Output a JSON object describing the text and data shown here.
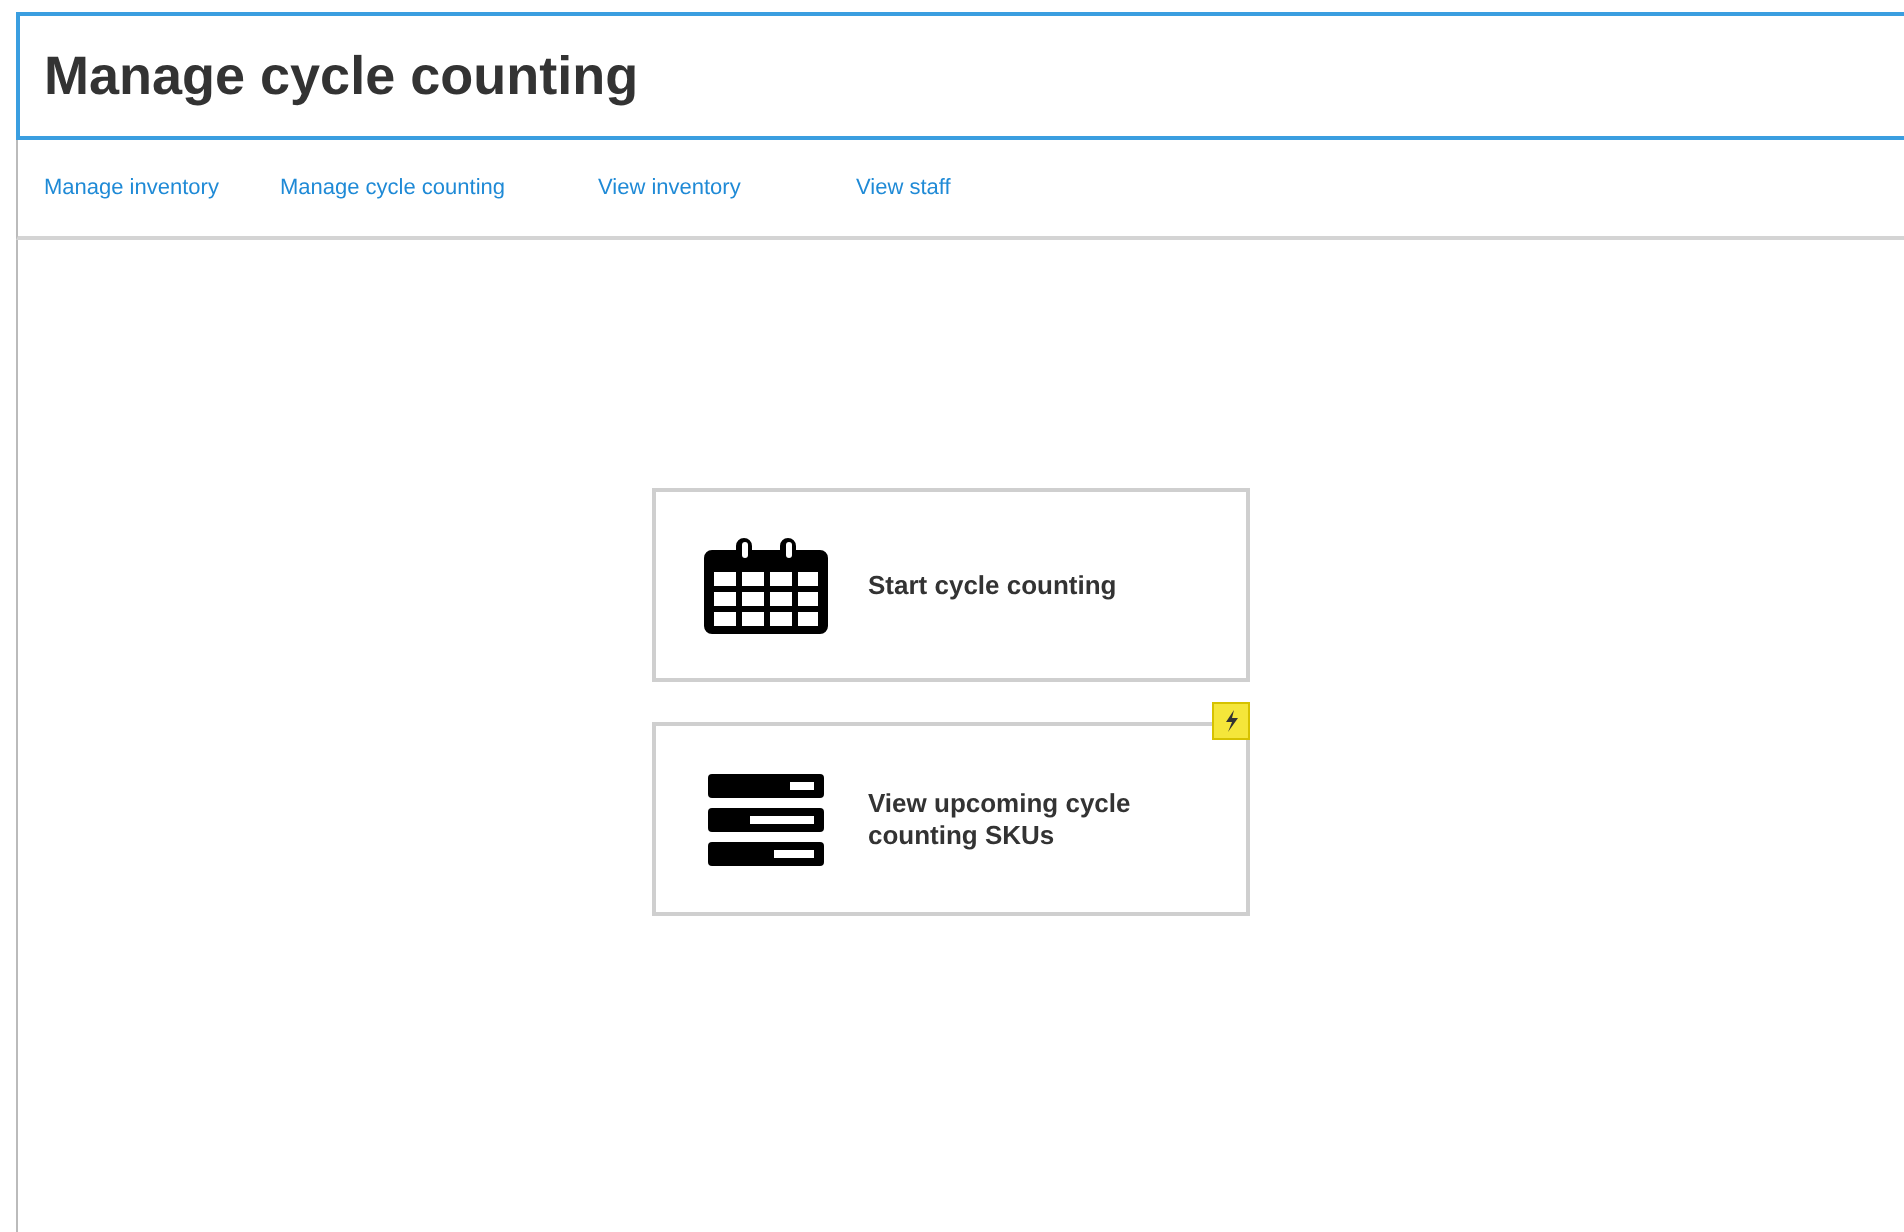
{
  "page": {
    "title": "Manage cycle counting"
  },
  "nav": [
    {
      "label": "Manage inventory"
    },
    {
      "label": "Manage cycle counting"
    },
    {
      "label": "View inventory"
    },
    {
      "label": "View staff"
    }
  ],
  "cards": [
    {
      "kind": "calendar",
      "label": "Start cycle counting",
      "flash": false
    },
    {
      "kind": "list",
      "label": "View upcoming cycle counting SKUs",
      "flash": true
    }
  ]
}
